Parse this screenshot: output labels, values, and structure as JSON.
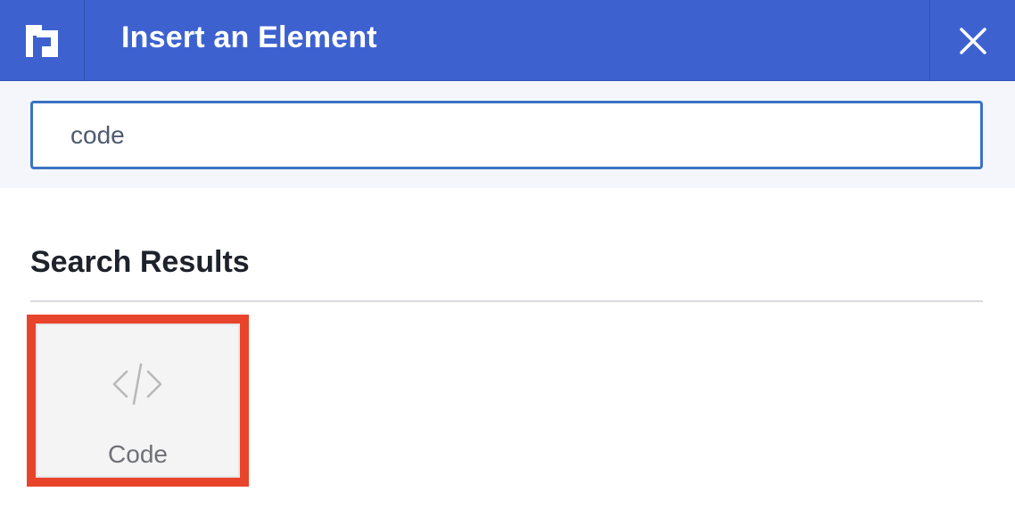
{
  "header": {
    "logo_icon": "brand-bracket-logo-icon",
    "title": "Insert an Element",
    "close_icon": "close-icon",
    "background": "#3d62d0"
  },
  "search": {
    "value": "code",
    "border_color": "#3b73c4"
  },
  "results": {
    "heading": "Search Results",
    "items": [
      {
        "label": "Code",
        "icon": "code-brackets-icon",
        "selected": true,
        "highlight_color": "#e8432b"
      }
    ]
  }
}
